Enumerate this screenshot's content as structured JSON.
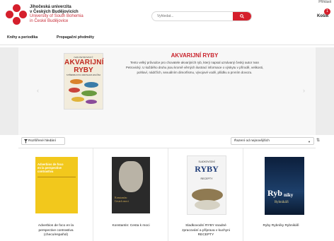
{
  "header": {
    "top_right_link": "Přihlásit",
    "university_cz_line1": "Jihočeská univerzita",
    "university_cz_line2": "v Českých Budějovicích",
    "university_en_line1": "University of South Bohemia",
    "university_en_line2": "in České Budějovice",
    "search_placeholder": "Vyhledat...",
    "cart_label": "Košík",
    "cart_count": "1",
    "brand_color": "#d51f2c"
  },
  "nav": {
    "items": [
      {
        "label": "Knihy a periodika"
      },
      {
        "label": "Propagační předměty"
      }
    ]
  },
  "banner": {
    "cover_pre": "IVAN PETROVICKÝ",
    "cover_title_1": "AKVARIJNÍ",
    "cover_title_2": "RYBY",
    "cover_sub": "S PŘEDMLUVOU JAROSLAVA HOLČÍKA",
    "title": "AKVARIJNÍ RYBY",
    "description": "Tento velký průvodce pro chovatele akvarijních ryb, který napsal uznávaný český autor Ivan Petrovický. U každého druhu jsou kromě věrných ilustrací informace o výskytu v přírodě, velikosti, pohlaví, nádržích, sexuálním dimorfismu, vývojové vodě, plůdku a prvním dovozu."
  },
  "toolbar": {
    "filter_label": "Rozšířené hledání",
    "sort_label": "Řazení od nejnovějších"
  },
  "products": [
    {
      "title_line1": "Adverbios de foco en la",
      "title_line2": "perspective contrastiva",
      "title_line3": "(checo/español)",
      "cover_text_1": "Adverbios de foco",
      "cover_text_2": "en la perspective",
      "cover_text_3": "contrastiva"
    },
    {
      "title_line1": "Konstantin: Cesta k moci",
      "title_line2": "",
      "title_line3": "",
      "cover_text_1": "Konstantin:",
      "cover_text_2": "Cesta k moci",
      "cover_text_3": ""
    },
    {
      "title_line1": "Sladkovodní RYBY snadné",
      "title_line2": "zpracování a příprava v kuchyni",
      "title_line3": "RECEPTY",
      "cover_text_1": "SLADKOVODNÍ",
      "cover_text_2": "RYBY",
      "cover_text_3": "RECEPTY"
    },
    {
      "title_line1": "Ryby Rybníky Rybnikáři",
      "title_line2": "",
      "title_line3": "",
      "cover_text_1": "Ryb",
      "cover_text_2": "níky",
      "cover_text_3": "Rybnikáři"
    }
  ]
}
